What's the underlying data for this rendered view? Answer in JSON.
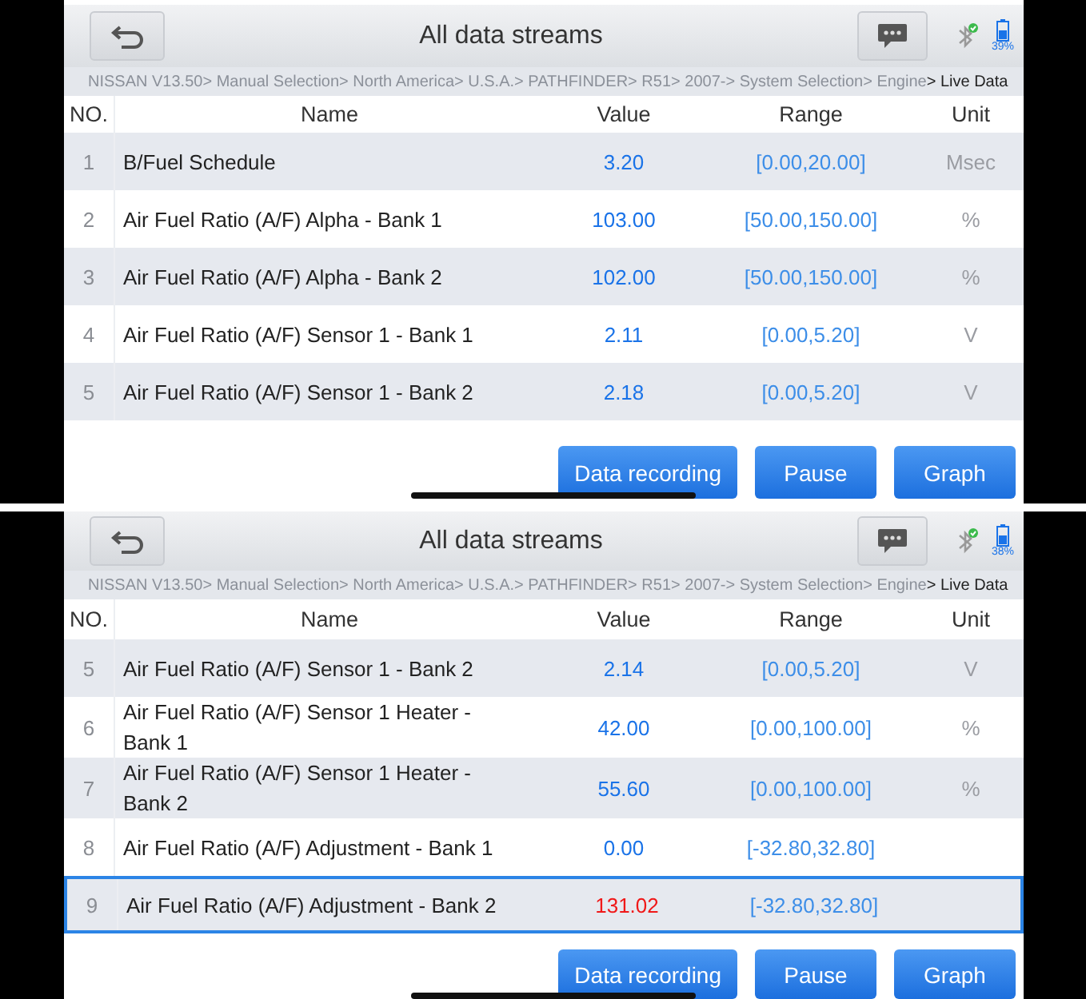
{
  "screens": [
    {
      "title": "All data streams",
      "battery": "39%",
      "breadcrumb": {
        "path": "NISSAN V13.50> Manual Selection> North America> U.S.A.> PATHFINDER> R51> 2007-> System Selection> Engine",
        "current": "> Live Data"
      },
      "columns": [
        "NO.",
        "Name",
        "Value",
        "Range",
        "Unit"
      ],
      "rows": [
        {
          "no": "1",
          "name": "B/Fuel Schedule",
          "value": "3.20",
          "range": "[0.00,20.00]",
          "unit": "Msec",
          "alarm": false,
          "selected": false
        },
        {
          "no": "2",
          "name": "Air Fuel Ratio (A/F) Alpha - Bank 1",
          "value": "103.00",
          "range": "[50.00,150.00]",
          "unit": "%",
          "alarm": false,
          "selected": false
        },
        {
          "no": "3",
          "name": "Air Fuel Ratio (A/F) Alpha - Bank 2",
          "value": "102.00",
          "range": "[50.00,150.00]",
          "unit": "%",
          "alarm": false,
          "selected": false
        },
        {
          "no": "4",
          "name": "Air Fuel Ratio (A/F) Sensor 1 - Bank 1",
          "value": "2.11",
          "range": "[0.00,5.20]",
          "unit": "V",
          "alarm": false,
          "selected": false
        },
        {
          "no": "5",
          "name": "Air Fuel Ratio (A/F) Sensor 1 - Bank 2",
          "value": "2.18",
          "range": "[0.00,5.20]",
          "unit": "V",
          "alarm": false,
          "selected": false
        }
      ],
      "buttons": [
        "Data recording",
        "Pause",
        "Graph"
      ]
    },
    {
      "title": "All data streams",
      "battery": "38%",
      "breadcrumb": {
        "path": "NISSAN V13.50> Manual Selection> North America> U.S.A.> PATHFINDER> R51> 2007-> System Selection> Engine",
        "current": "> Live Data"
      },
      "columns": [
        "NO.",
        "Name",
        "Value",
        "Range",
        "Unit"
      ],
      "rows": [
        {
          "no": "5",
          "name": "Air Fuel Ratio (A/F) Sensor 1 - Bank 2",
          "value": "2.14",
          "range": "[0.00,5.20]",
          "unit": "V",
          "alarm": false,
          "selected": false
        },
        {
          "no": "6",
          "name": "Air Fuel Ratio (A/F) Sensor 1 Heater - Bank 1",
          "value": "42.00",
          "range": "[0.00,100.00]",
          "unit": "%",
          "alarm": false,
          "selected": false
        },
        {
          "no": "7",
          "name": "Air Fuel Ratio (A/F) Sensor 1 Heater - Bank 2",
          "value": "55.60",
          "range": "[0.00,100.00]",
          "unit": "%",
          "alarm": false,
          "selected": false
        },
        {
          "no": "8",
          "name": "Air Fuel Ratio (A/F) Adjustment - Bank 1",
          "value": "0.00",
          "range": "[-32.80,32.80]",
          "alarm": false,
          "selected": false
        },
        {
          "no": "9",
          "name": "Air Fuel Ratio (A/F) Adjustment - Bank 2",
          "value": "131.02",
          "range": "[-32.80,32.80]",
          "alarm": true,
          "selected": true
        }
      ],
      "buttons": [
        "Data recording",
        "Pause",
        "Graph"
      ]
    }
  ]
}
